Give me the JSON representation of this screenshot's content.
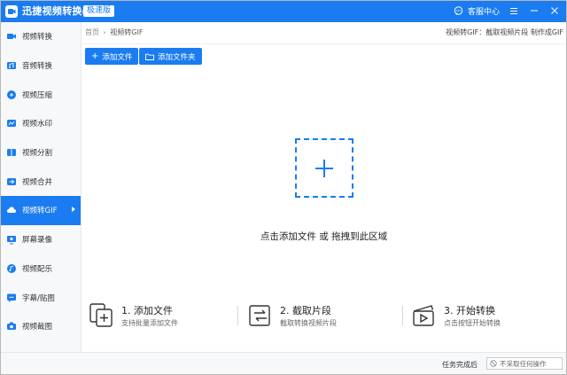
{
  "app": {
    "title": "迅捷视频转换器",
    "badge": "极速版"
  },
  "titlebar": {
    "support_label": "客服中心"
  },
  "sidebar": {
    "items": [
      {
        "label": "视频转换",
        "icon": "video-convert-icon"
      },
      {
        "label": "音频转换",
        "icon": "audio-convert-icon"
      },
      {
        "label": "视频压缩",
        "icon": "video-compress-icon"
      },
      {
        "label": "视频水印",
        "icon": "watermark-icon"
      },
      {
        "label": "视频分割",
        "icon": "video-split-icon"
      },
      {
        "label": "视频合并",
        "icon": "video-merge-icon"
      },
      {
        "label": "视频转GIF",
        "icon": "gif-icon",
        "active": true
      },
      {
        "label": "屏幕录像",
        "icon": "screen-record-icon"
      },
      {
        "label": "视频配乐",
        "icon": "music-icon"
      },
      {
        "label": "字幕/贴图",
        "icon": "subtitle-icon"
      },
      {
        "label": "视频截图",
        "icon": "screenshot-icon"
      }
    ]
  },
  "breadcrumb": {
    "home": "首页",
    "separator": "›",
    "current": "视频转GIF"
  },
  "hint": "视频转GIF：截取视频片段 制作成GIF",
  "toolbar": {
    "add_file": "添加文件",
    "add_folder": "添加文件夹"
  },
  "dropzone": {
    "text": "点击添加文件 或 拖拽到此区域"
  },
  "steps": [
    {
      "title": "1. 添加文件",
      "desc": "支持批量添加文件",
      "icon": "add-files-icon"
    },
    {
      "title": "2. 截取片段",
      "desc": "截取转换视频片段",
      "icon": "clip-segment-icon"
    },
    {
      "title": "3. 开始转换",
      "desc": "点击按钮开始转换",
      "icon": "start-convert-icon"
    }
  ],
  "status": {
    "label": "任务完成后",
    "select_value": "不采取任何操作"
  },
  "colors": {
    "accent": "#1a7cf0",
    "sidebar_bg": "#f7f8fa",
    "text": "#222222"
  }
}
